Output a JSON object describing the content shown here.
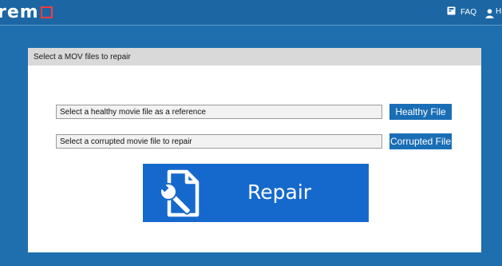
{
  "app": {
    "logo_text": "rem",
    "faq_label": "FAQ",
    "user_label": "H"
  },
  "panel": {
    "title": "Select a MOV files to repair",
    "healthy": {
      "placeholder": "Select a healthy movie file as a reference",
      "button_label": "Healthy File"
    },
    "corrupted": {
      "placeholder": "Select a corrupted movie file to repair",
      "button_label": "Corrupted File"
    },
    "repair_label": "Repair"
  },
  "colors": {
    "background": "#1f6fae",
    "accent": "#1a6eb5",
    "repair_button": "#1669cc",
    "logo_mark": "#ff3b3b"
  }
}
